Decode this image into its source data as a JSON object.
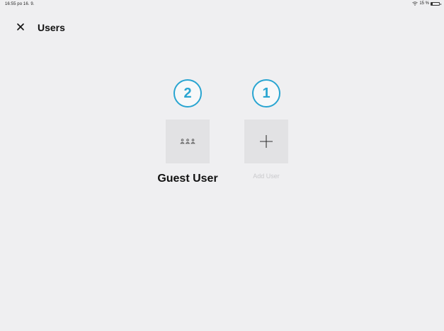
{
  "status_bar": {
    "time": "16:55  po 16. 9.",
    "battery_text": "15 %",
    "battery_level": 0.15
  },
  "header": {
    "title": "Users",
    "close_icon": "close-icon"
  },
  "users": [
    {
      "label": "Guest User",
      "badge": "2",
      "icon": "people-icon"
    },
    {
      "label": "Add User",
      "badge": "1",
      "icon": "plus-icon"
    }
  ],
  "colors": {
    "background": "#efeff1",
    "badge_accent": "#29a5d1",
    "tile_background": "#e2e2e4",
    "disabled_text": "#c9c9cc"
  }
}
